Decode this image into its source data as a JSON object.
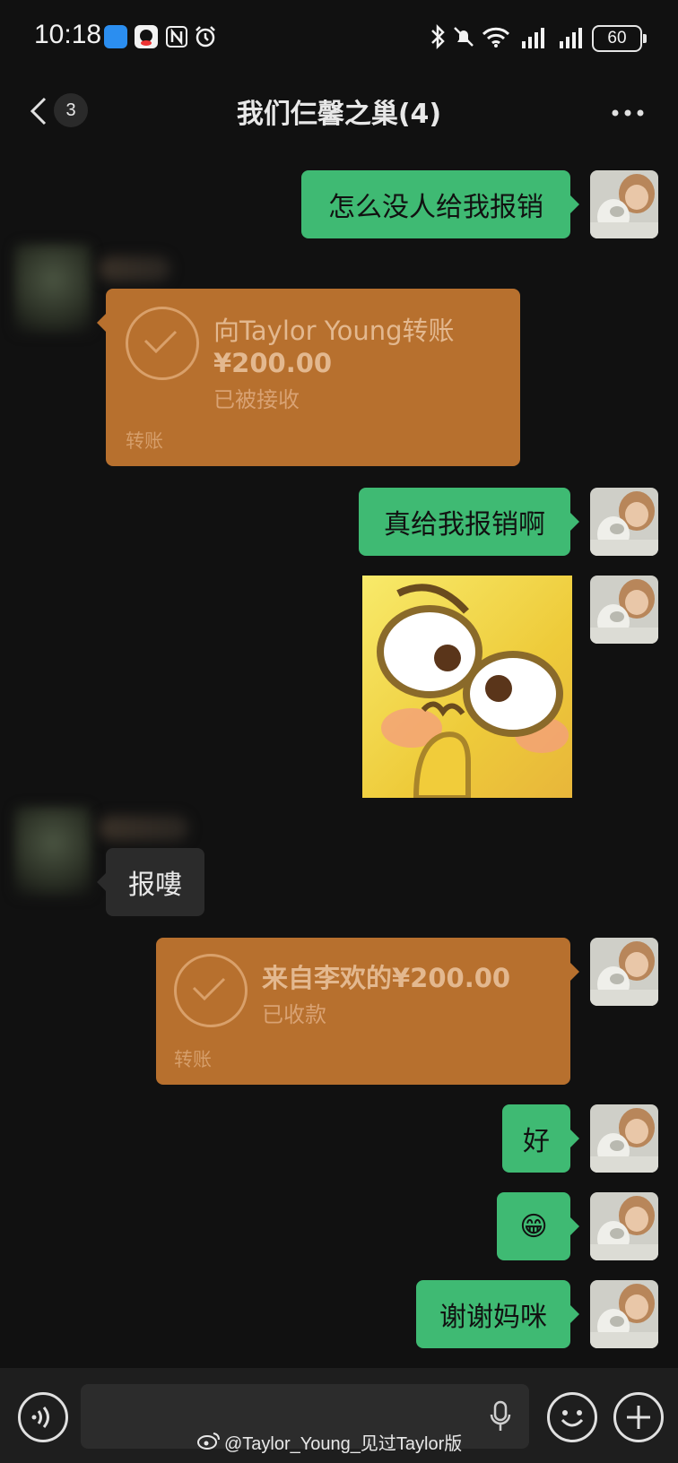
{
  "status_bar": {
    "time": "10:18",
    "battery": "60"
  },
  "nav": {
    "back_count": "3",
    "title": "我们仨馨之巢(4)"
  },
  "messages": {
    "m1": "怎么没人给我报销",
    "transfer1": {
      "title": "向Taylor Young转账",
      "amount": "¥200.00",
      "status": "已被接收",
      "footer": "转账"
    },
    "m2": "真给我报销啊",
    "m3": "报嘍",
    "transfer2": {
      "title": "来自李欢的¥200.00",
      "status": "已收款",
      "footer": "转账"
    },
    "m4": "好",
    "m5": "😁",
    "m6": "谢谢妈咪"
  },
  "watermark": "@Taylor_Young_见过Taylor版",
  "colors": {
    "background": "#111111",
    "green_bubble": "#3fba73",
    "transfer": "#b7702e"
  }
}
